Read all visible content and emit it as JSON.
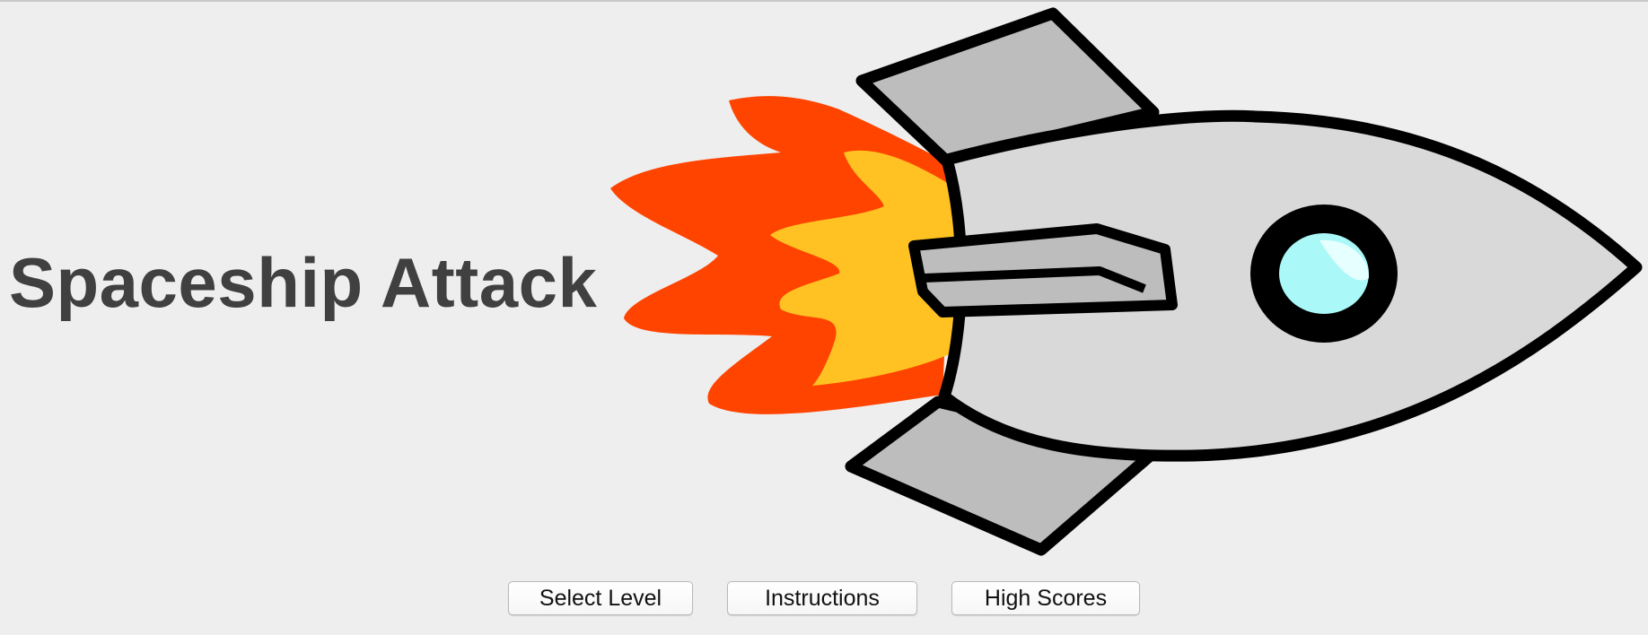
{
  "title": "Spaceship Attack",
  "menu": {
    "select_level": "Select Level",
    "instructions": "Instructions",
    "high_scores": "High Scores"
  },
  "rocket": {
    "body_color": "#d9d9d9",
    "fin_color": "#bdbdbd",
    "outline_color": "#000000",
    "window_color": "#aaf8f8",
    "flame_outer_color": "#ff4400",
    "flame_inner_color": "#ffc222"
  },
  "colors": {
    "background": "#eeeeee",
    "title_text": "#404040"
  }
}
